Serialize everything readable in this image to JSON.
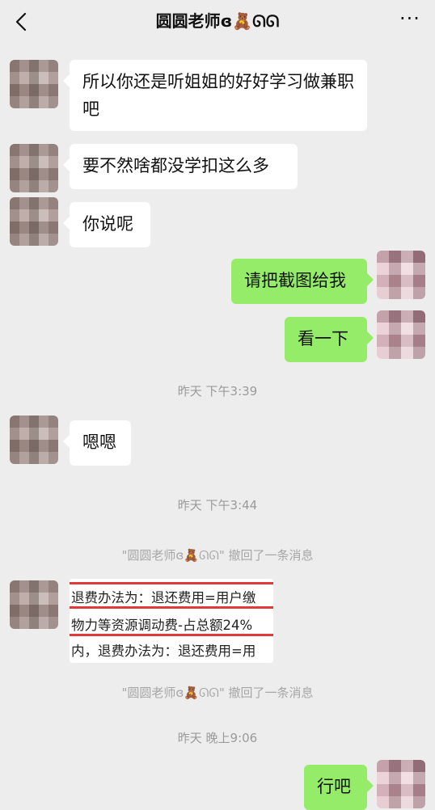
{
  "header": {
    "title": "圆圆老师ɞ🧸ᘏᘏ",
    "more_label": "···"
  },
  "messages": [
    {
      "side": "in",
      "text": "所以你还是听姐姐的好好学习做兼职吧"
    },
    {
      "side": "in",
      "text": "要不然啥都没学扣这么多"
    },
    {
      "side": "in",
      "text": "你说呢"
    },
    {
      "side": "out",
      "text": "请把截图给我"
    },
    {
      "side": "out",
      "text": "看一下"
    },
    {
      "side": "in",
      "text": "嗯嗯"
    },
    {
      "side": "out",
      "text": "行吧"
    }
  ],
  "times": [
    "昨天 下午3:39",
    "昨天 下午3:44",
    "昨天 晚上9:06"
  ],
  "recalls": [
    "\"圆圆老师ɞ🧸ᘏᘏ\" 撤回了一条消息",
    "\"圆圆老师ɞ🧸ᘏᘏ\" 撤回了一条消息"
  ],
  "image_message": {
    "lines": [
      "退费办法为：退还费用=用户缴",
      "物力等资源调动费-占总额24%",
      "内，退费办法为：退还费用=用"
    ]
  },
  "colors": {
    "background": "#ededed",
    "bubble_in": "#ffffff",
    "bubble_out": "#95ec69",
    "accent_red": "#e23a3a"
  },
  "icons": {
    "back": "chevron-left-icon",
    "more": "more-dots-icon"
  }
}
